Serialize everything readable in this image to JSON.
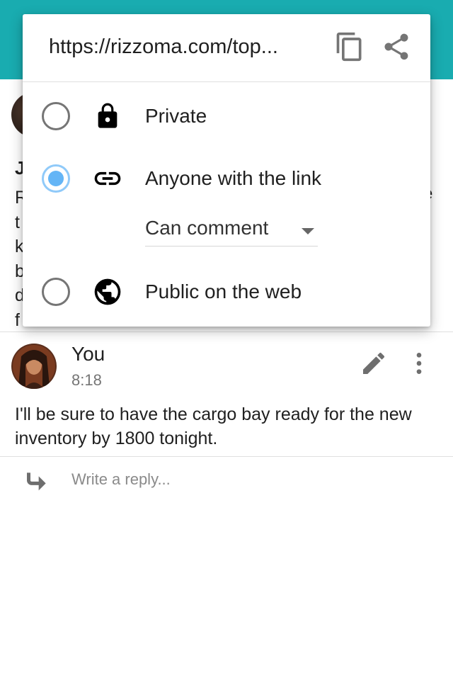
{
  "share_dialog": {
    "url": "https://rizzoma.com/top...",
    "options": [
      {
        "label": "Private",
        "icon": "lock-icon",
        "selected": false
      },
      {
        "label": "Anyone with the link",
        "icon": "link-icon",
        "selected": true
      },
      {
        "label": "Public on the web",
        "icon": "globe-icon",
        "selected": false
      }
    ],
    "permission_value": "Can comment"
  },
  "background": {
    "initial": "J",
    "text_lines": [
      "R",
      "t",
      "k",
      "b",
      "d",
      "f"
    ],
    "trailing_char": "e"
  },
  "comment": {
    "author": "You",
    "time": "8:18",
    "body": "I'll be sure to have the cargo bay ready for the new inventory by 1800 tonight."
  },
  "reply": {
    "placeholder": "Write a reply..."
  },
  "colors": {
    "app_bar": "#19acb0",
    "radio_selected": "#64b5f6"
  }
}
